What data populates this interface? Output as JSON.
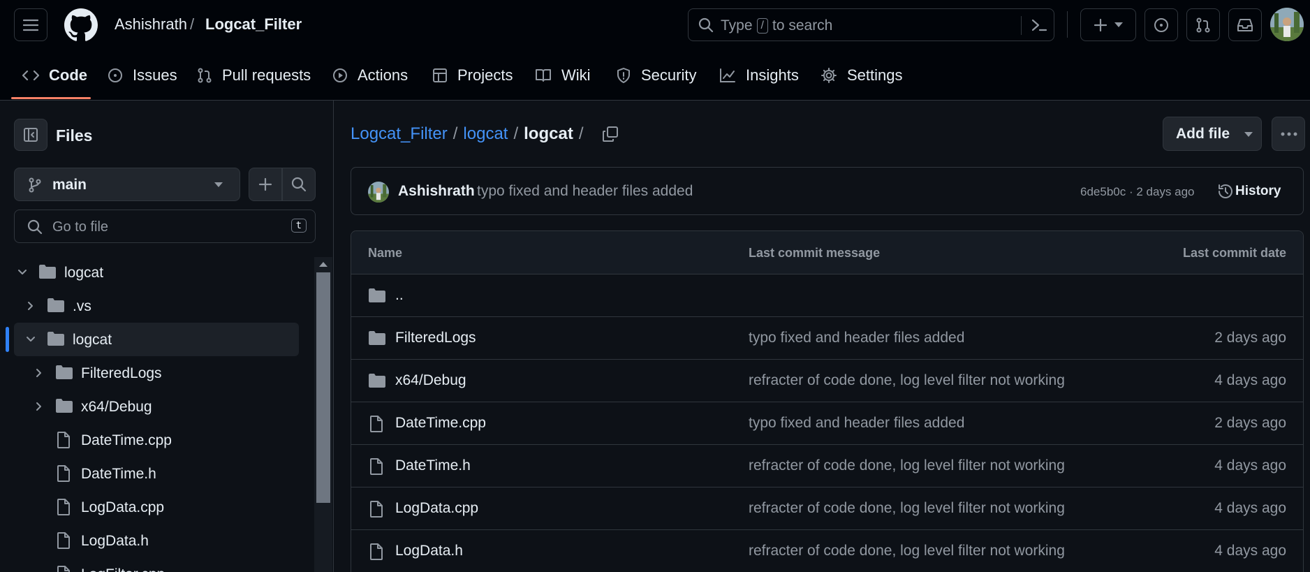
{
  "header": {
    "owner": "Ashishrath",
    "separator": "/",
    "repo": "Logcat_Filter",
    "search": {
      "before": "Type",
      "key": "/",
      "after": "to search"
    }
  },
  "tabs": [
    {
      "label": "Code",
      "icon": "code-icon",
      "selected": true
    },
    {
      "label": "Issues",
      "icon": "issue-icon"
    },
    {
      "label": "Pull requests",
      "icon": "pull-request-icon"
    },
    {
      "label": "Actions",
      "icon": "play-icon"
    },
    {
      "label": "Projects",
      "icon": "table-icon"
    },
    {
      "label": "Wiki",
      "icon": "book-icon"
    },
    {
      "label": "Security",
      "icon": "shield-icon"
    },
    {
      "label": "Insights",
      "icon": "graph-icon"
    },
    {
      "label": "Settings",
      "icon": "gear-icon"
    }
  ],
  "sidebar": {
    "title": "Files",
    "branch": "main",
    "goto_placeholder": "Go to file",
    "goto_key": "t",
    "tree": [
      {
        "label": "logcat",
        "type": "folder",
        "expanded": true,
        "level": 0
      },
      {
        "label": ".vs",
        "type": "folder",
        "expanded": false,
        "level": 1
      },
      {
        "label": "logcat",
        "type": "folder",
        "expanded": true,
        "level": 1,
        "selected": true
      },
      {
        "label": "FilteredLogs",
        "type": "folder",
        "expanded": false,
        "level": 2
      },
      {
        "label": "x64/Debug",
        "type": "folder",
        "expanded": false,
        "level": 2
      },
      {
        "label": "DateTime.cpp",
        "type": "file",
        "level": 2
      },
      {
        "label": "DateTime.h",
        "type": "file",
        "level": 2
      },
      {
        "label": "LogData.cpp",
        "type": "file",
        "level": 2
      },
      {
        "label": "LogData.h",
        "type": "file",
        "level": 2
      },
      {
        "label": "LogFilter.cpp",
        "type": "file",
        "level": 2
      }
    ]
  },
  "breadcrumb": {
    "parts": [
      "Logcat_Filter",
      "logcat"
    ],
    "current": "logcat",
    "trailing_sep": "/"
  },
  "actions": {
    "add_file": "Add file"
  },
  "latest_commit": {
    "author": "Ashishrath",
    "message": "typo fixed and header files added",
    "hash_age": "6de5b0c · 2 days ago",
    "history_label": "History"
  },
  "table": {
    "headers": {
      "name": "Name",
      "message": "Last commit message",
      "date": "Last commit date"
    },
    "parent": "..",
    "rows": [
      {
        "name": "FilteredLogs",
        "type": "folder",
        "message": "typo fixed and header files added",
        "date": "2 days ago"
      },
      {
        "name": "x64/Debug",
        "type": "folder",
        "message": "refracter of code done, log level filter not working",
        "date": "4 days ago"
      },
      {
        "name": "DateTime.cpp",
        "type": "file",
        "message": "typo fixed and header files added",
        "date": "2 days ago"
      },
      {
        "name": "DateTime.h",
        "type": "file",
        "message": "refracter of code done, log level filter not working",
        "date": "4 days ago"
      },
      {
        "name": "LogData.cpp",
        "type": "file",
        "message": "refracter of code done, log level filter not working",
        "date": "4 days ago"
      },
      {
        "name": "LogData.h",
        "type": "file",
        "message": "refracter of code done, log level filter not working",
        "date": "4 days ago"
      }
    ]
  },
  "colors": {
    "background": "#0d1117",
    "header": "#010409",
    "border": "#30363d",
    "link": "#4493f8",
    "muted": "#9198a1",
    "tab_underline": "#f78166",
    "selection_bar": "#2f81f7"
  }
}
